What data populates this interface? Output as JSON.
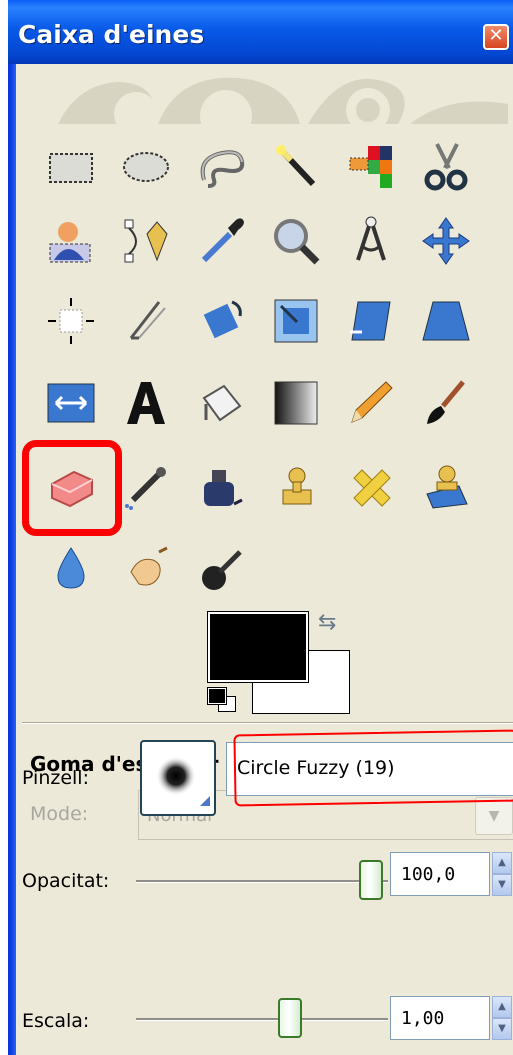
{
  "window": {
    "title": "Caixa d'eines",
    "close_glyph": "✕"
  },
  "tools": [
    {
      "name": "rect-select-icon"
    },
    {
      "name": "ellipse-select-icon"
    },
    {
      "name": "free-select-icon"
    },
    {
      "name": "fuzzy-select-icon"
    },
    {
      "name": "color-select-icon"
    },
    {
      "name": "scissors-icon"
    },
    {
      "name": "foreground-select-icon"
    },
    {
      "name": "paths-icon"
    },
    {
      "name": "color-picker-icon"
    },
    {
      "name": "zoom-icon"
    },
    {
      "name": "measure-icon"
    },
    {
      "name": "move-icon"
    },
    {
      "name": "align-icon"
    },
    {
      "name": "crop-icon"
    },
    {
      "name": "rotate-icon"
    },
    {
      "name": "scale-icon"
    },
    {
      "name": "shear-icon"
    },
    {
      "name": "perspective-icon"
    },
    {
      "name": "flip-icon"
    },
    {
      "name": "text-icon"
    },
    {
      "name": "bucket-fill-icon"
    },
    {
      "name": "blend-icon"
    },
    {
      "name": "pencil-icon"
    },
    {
      "name": "paintbrush-icon"
    },
    {
      "name": "eraser-icon"
    },
    {
      "name": "airbrush-icon"
    },
    {
      "name": "ink-icon"
    },
    {
      "name": "clone-icon"
    },
    {
      "name": "heal-icon"
    },
    {
      "name": "perspective-clone-icon"
    },
    {
      "name": "blur-icon"
    },
    {
      "name": "smudge-icon"
    },
    {
      "name": "dodge-burn-icon"
    }
  ],
  "colors": {
    "foreground": "#000000",
    "background": "#ffffff",
    "highlight": "#ff0000"
  },
  "options": {
    "title": "Goma d'esborrar",
    "menu_glyph": "◂",
    "mode_label": "Mode:",
    "mode_value": "Normal",
    "opacity_label": "Opacitat:",
    "opacity_value": "100,0",
    "opacity_fraction": 1.0,
    "brush_label": "Pinzell:",
    "brush_name": "Circle Fuzzy (19)",
    "scale_label": "Escala:",
    "scale_value": "1,00"
  }
}
